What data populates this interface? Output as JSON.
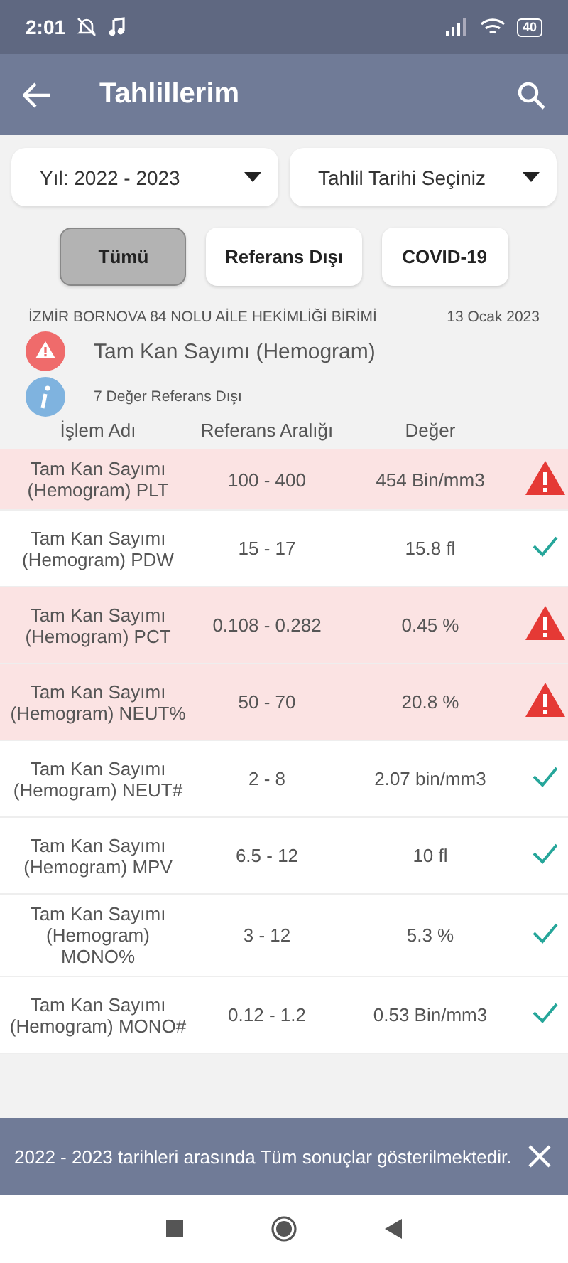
{
  "status_bar": {
    "time": "2:01",
    "battery": "40"
  },
  "app_bar": {
    "title": "Tahlillerim"
  },
  "filters": [
    {
      "label": "Yıl: 2022 - 2023"
    },
    {
      "label": "Tahlil Tarihi Seçiniz"
    }
  ],
  "segments": [
    {
      "label": "Tümü",
      "selected": true
    },
    {
      "label": "Referans Dışı",
      "selected": false
    },
    {
      "label": "COVID-19",
      "selected": false
    }
  ],
  "report": {
    "institution": "İZMİR BORNOVA 84 NOLU AİLE HEKİMLİĞİ BİRİMİ",
    "date": "13 Ocak 2023",
    "test_name": "Tam Kan Sayımı (Hemogram)",
    "summary": "7 Değer Referans Dışı"
  },
  "table": {
    "columns": [
      "İşlem Adı",
      "Referans Aralığı",
      "Değer"
    ],
    "rows": [
      {
        "name": "Tam Kan Sayımı (Hemogram) PLT",
        "range": "100 - 400",
        "value": "454 Bin/mm3",
        "out_of_range": true
      },
      {
        "name": "Tam Kan Sayımı (Hemogram) PDW",
        "range": "15 - 17",
        "value": "15.8 fl",
        "out_of_range": false
      },
      {
        "name": "Tam Kan Sayımı (Hemogram) PCT",
        "range": "0.108 - 0.282",
        "value": "0.45 %",
        "out_of_range": true
      },
      {
        "name": "Tam Kan Sayımı (Hemogram) NEUT%",
        "range": "50 - 70",
        "value": "20.8 %",
        "out_of_range": true
      },
      {
        "name": "Tam Kan Sayımı (Hemogram) NEUT#",
        "range": "2 - 8",
        "value": "2.07 bin/mm3",
        "out_of_range": false
      },
      {
        "name": "Tam Kan Sayımı (Hemogram) MPV",
        "range": "6.5 - 12",
        "value": "10 fl",
        "out_of_range": false
      },
      {
        "name": "Tam Kan Sayımı (Hemogram) MONO%",
        "range": "3 - 12",
        "value": "5.3 %",
        "out_of_range": false
      },
      {
        "name": "Tam Kan Sayımı (Hemogram) MONO#",
        "range": "0.12 - 1.2",
        "value": "0.53 Bin/mm3",
        "out_of_range": false
      }
    ]
  },
  "snackbar": {
    "message": "2022 - 2023 tarihleri arasında Tüm sonuçlar gösterilmektedir."
  }
}
